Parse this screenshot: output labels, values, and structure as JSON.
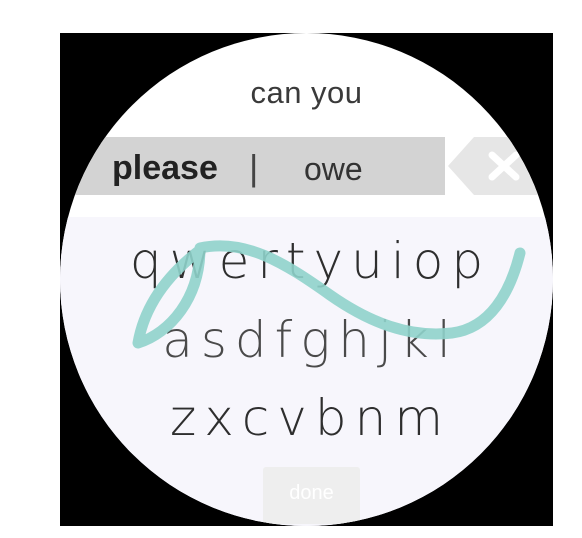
{
  "input": {
    "composed_text": "can you"
  },
  "suggestions": {
    "primary": "please",
    "divider": "|",
    "secondary": "owe"
  },
  "keyboard": {
    "rows": [
      [
        "q",
        "w",
        "e",
        "r",
        "t",
        "y",
        "u",
        "i",
        "o",
        "p"
      ],
      [
        "a",
        "s",
        "d",
        "f",
        "g",
        "h",
        "j",
        "k",
        "l"
      ],
      [
        "z",
        "x",
        "c",
        "v",
        "b",
        "n",
        "m"
      ]
    ]
  },
  "done_label": "done",
  "icons": {
    "delete": "backspace-x-icon"
  },
  "colors": {
    "trail": "#8fd3cb",
    "suggestion_bar": "#d3d3d3",
    "keyboard_bg": "#f7f6fc"
  }
}
